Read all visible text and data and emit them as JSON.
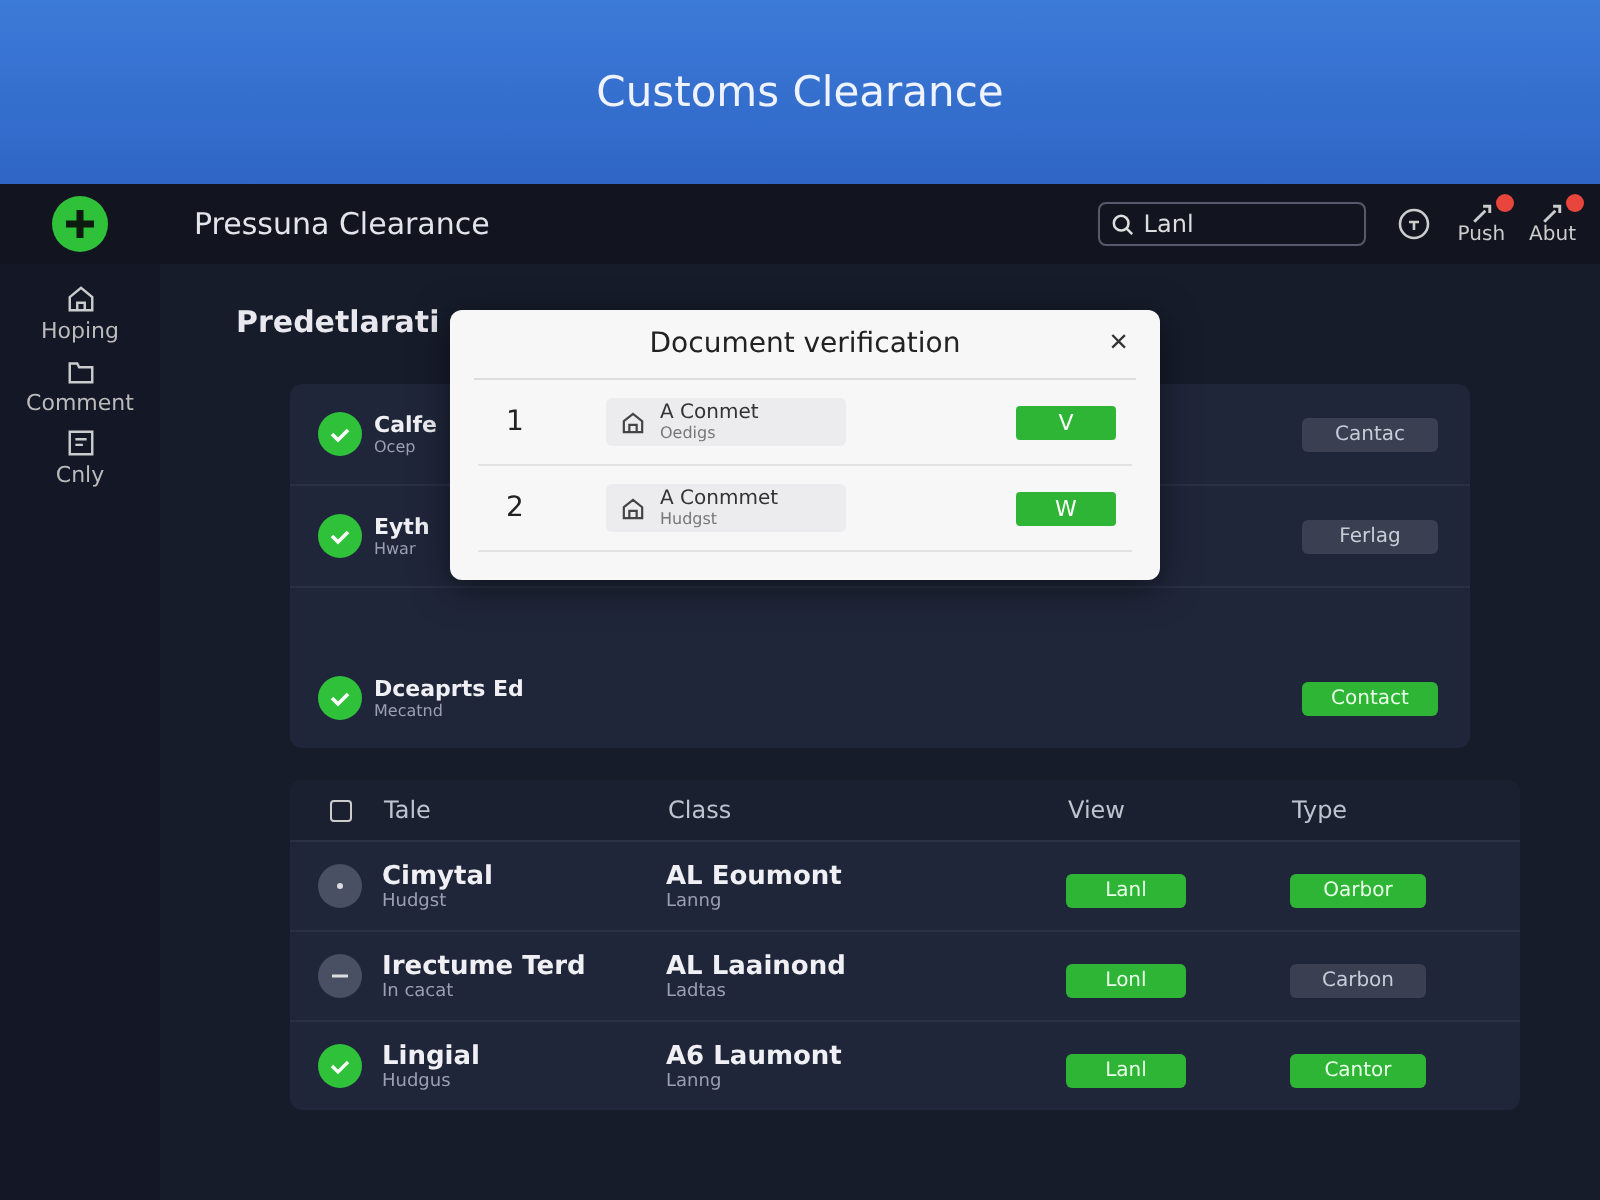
{
  "header": {
    "title": "Customs Clearance"
  },
  "topbar": {
    "title": "Pressuna Clearance",
    "search": {
      "value": "Lanl"
    },
    "actions": [
      {
        "label": "Push",
        "badge": true
      },
      {
        "label": "Abut",
        "badge": true
      }
    ]
  },
  "sidebar": {
    "items": [
      {
        "label": "Hoping"
      },
      {
        "label": "Comment"
      },
      {
        "label": "Cnly"
      }
    ]
  },
  "heading": "Predetlarati",
  "list": {
    "rows": [
      {
        "title": "Calfe",
        "subtitle": "Ocep",
        "button": "Cantac",
        "active": false
      },
      {
        "title": "Eyth",
        "subtitle": "Hwar",
        "button": "Ferlag",
        "active": false
      },
      {
        "title": "Dceaprts Ed",
        "subtitle": "Mecatnd",
        "button": "Contact",
        "active": true
      }
    ]
  },
  "dialog": {
    "title": "Document verification",
    "close": "×",
    "rows": [
      {
        "number": "1",
        "name": "A Conmet",
        "detail": "Oedigs",
        "button": "V"
      },
      {
        "number": "2",
        "name": "A Conmmet",
        "detail": "Hudgst",
        "button": "W"
      }
    ]
  },
  "table": {
    "checked": false,
    "columns": [
      "Tale",
      "Class",
      "View",
      "Type"
    ],
    "rows": [
      {
        "kind": "dot",
        "title": "Cimytal",
        "subtitle": "Hudgst",
        "class": "AL Eoumont",
        "class_sub": "Lanng",
        "view": "Lanl",
        "type": "Oarbor",
        "type_active": true
      },
      {
        "kind": "dash",
        "title": "Irectume Terd",
        "subtitle": "In cacat",
        "class": "AL Laainond",
        "class_sub": "Ladtas",
        "view": "Lonl",
        "type": "Carbon",
        "type_active": false
      },
      {
        "kind": "check",
        "title": "Lingial",
        "subtitle": "Hudgus",
        "class": "A6 Laumont",
        "class_sub": "Lanng",
        "view": "Lanl",
        "type": "Cantor",
        "type_active": true
      }
    ]
  }
}
